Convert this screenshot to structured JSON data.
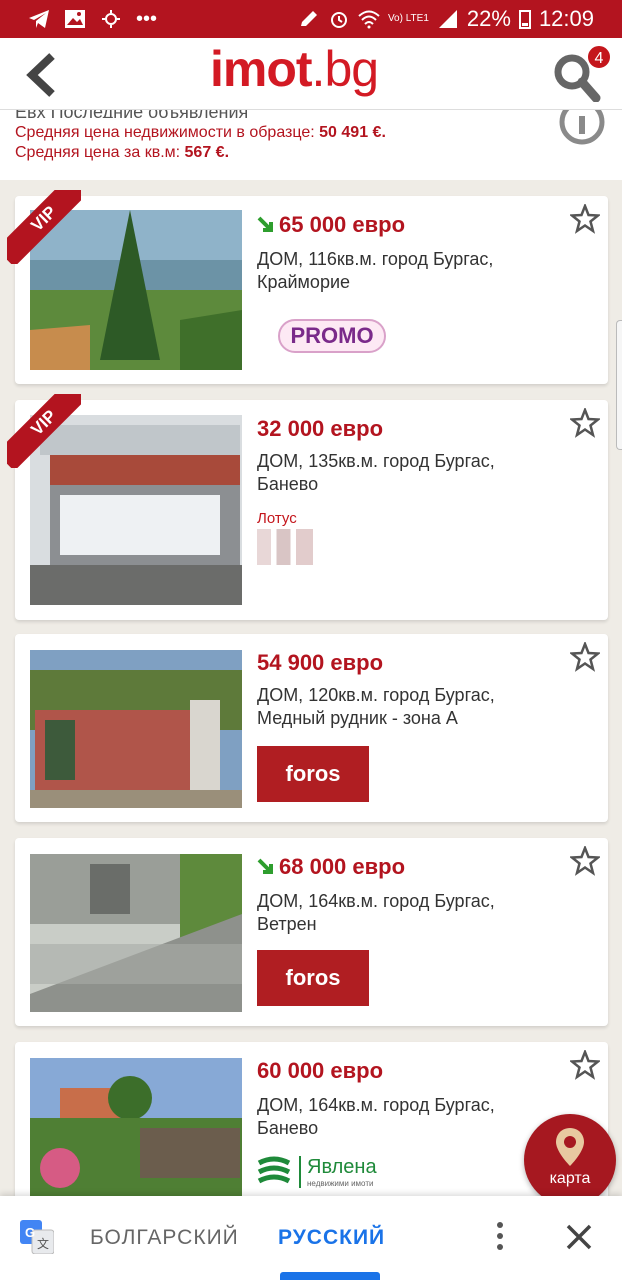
{
  "status": {
    "battery": "22%",
    "time": "12:09",
    "network": "Vo) LTE1"
  },
  "header": {
    "logo_main": "imot",
    "logo_tld": ".bg",
    "search_badge": "4"
  },
  "info": {
    "cut_line": "Евх Последние объявления",
    "avg_price_label": "Средняя цена недвижимости в образце:",
    "avg_price_value": "50 491 €.",
    "avg_sqm_label": "Средняя цена за кв.м:",
    "avg_sqm_value": "567 €."
  },
  "listings": [
    {
      "vip": "VIP",
      "price": "65 000 евро",
      "price_down": true,
      "desc": "ДОМ, 116кв.м. город Бургас, Крайморие",
      "agency": "PROMO"
    },
    {
      "vip": "VIP",
      "price": "32 000 евро",
      "price_down": false,
      "desc": "ДОМ, 135кв.м. город Бургас, Банево",
      "agency": "Лотус"
    },
    {
      "vip": "",
      "price": "54 900 евро",
      "price_down": false,
      "desc": "ДОМ, 120кв.м. город Бургас, Медный рудник - зона А",
      "agency": "foros"
    },
    {
      "vip": "",
      "price": "68 000 евро",
      "price_down": true,
      "desc": "ДОМ, 164кв.м. город Бургас, Ветрен",
      "agency": "foros"
    },
    {
      "vip": "",
      "price": "60 000 евро",
      "price_down": false,
      "desc": "ДОМ, 164кв.м. город Бургас, Банево",
      "agency": "Явлена",
      "agency_sub": "недвижими имоти"
    }
  ],
  "map_button": {
    "label": "карта"
  },
  "translate": {
    "source_lang": "БОЛГАРСКИЙ",
    "target_lang": "РУССКИЙ"
  },
  "colors": {
    "brand": "#b3141f",
    "accent_blue": "#1a73e8",
    "price_down_arrow": "#2e9e2e"
  }
}
